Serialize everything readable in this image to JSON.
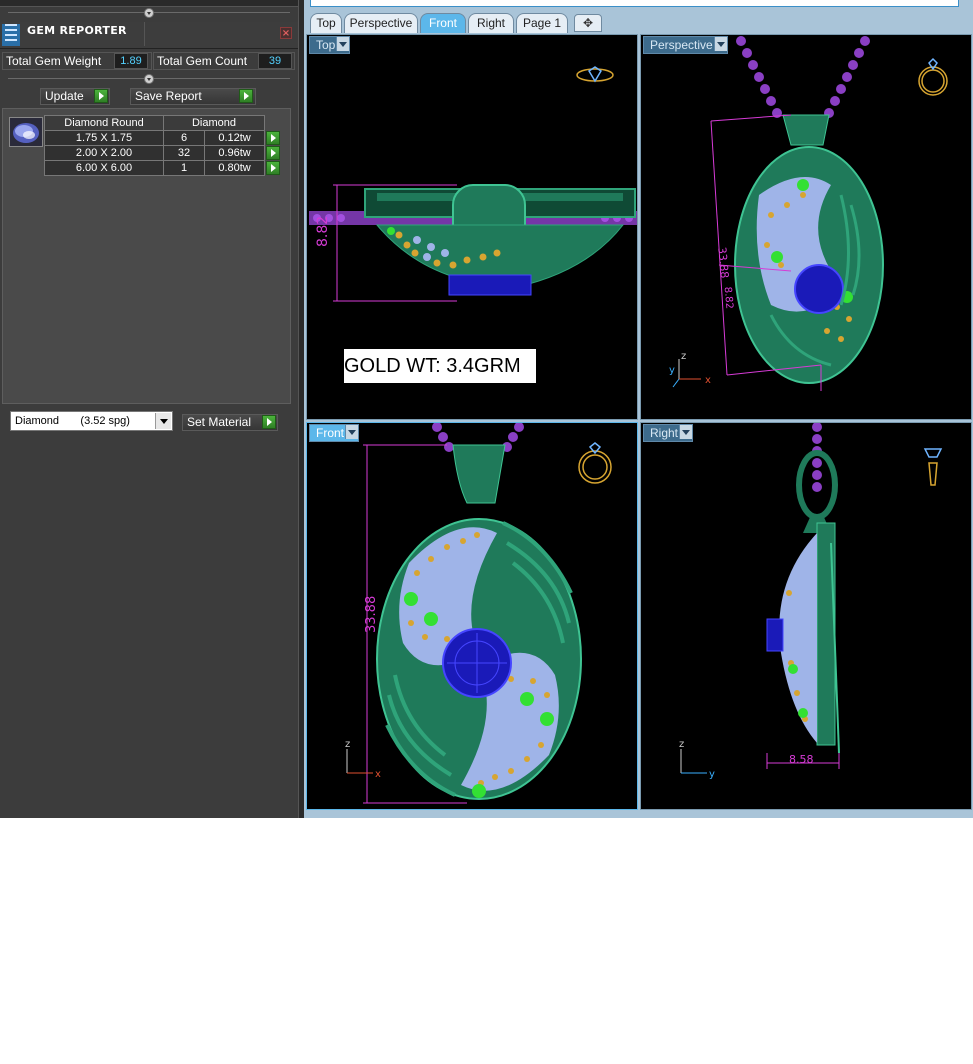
{
  "panel": {
    "title": "GEM REPORTER",
    "close": "×",
    "total_weight_label": "Total Gem Weight",
    "total_weight_value": "1.89",
    "total_count_label": "Total Gem Count",
    "total_count_value": "39",
    "update_label": "Update",
    "save_label": "Save Report",
    "table": {
      "headers": [
        "Diamond Round",
        "Diamond"
      ],
      "rows": [
        {
          "size": "1.75 X 1.75",
          "count": "6",
          "weight": "0.12tw"
        },
        {
          "size": "2.00 X 2.00",
          "count": "32",
          "weight": "0.96tw"
        },
        {
          "size": "6.00 X 6.00",
          "count": "1",
          "weight": "0.80tw"
        }
      ]
    },
    "material_value": "Diamond       (3.52 spg)",
    "set_material_label": "Set Material"
  },
  "tabs": [
    {
      "label": "Top",
      "active": false
    },
    {
      "label": "Perspective",
      "active": false
    },
    {
      "label": "Front",
      "active": true
    },
    {
      "label": "Right",
      "active": false
    },
    {
      "label": "Page 1",
      "active": false
    }
  ],
  "tab_add": "✥",
  "viewports": {
    "top": {
      "label": "Top",
      "dim": "8.82",
      "gold_label": "GOLD WT: 3.4GRM"
    },
    "perspective": {
      "label": "Perspective",
      "dim1": "33.88",
      "dim2": "8.82",
      "axis_z": "z",
      "axis_x": "x",
      "axis_y": "y"
    },
    "front": {
      "label": "Front",
      "dim": "33.88",
      "axis_z": "z",
      "axis_x": "x"
    },
    "right": {
      "label": "Right",
      "dim": "8.58",
      "axis_z": "z",
      "axis_y": "y"
    }
  },
  "colors": {
    "metal": "#1f7a5a",
    "pave": "#9fb4e8",
    "bead": "#d7a531",
    "accent_gem": "#33e033",
    "center_stone": "#1a1ab8",
    "chain": "#8a3fc4",
    "dimension": "#d63bd6"
  }
}
